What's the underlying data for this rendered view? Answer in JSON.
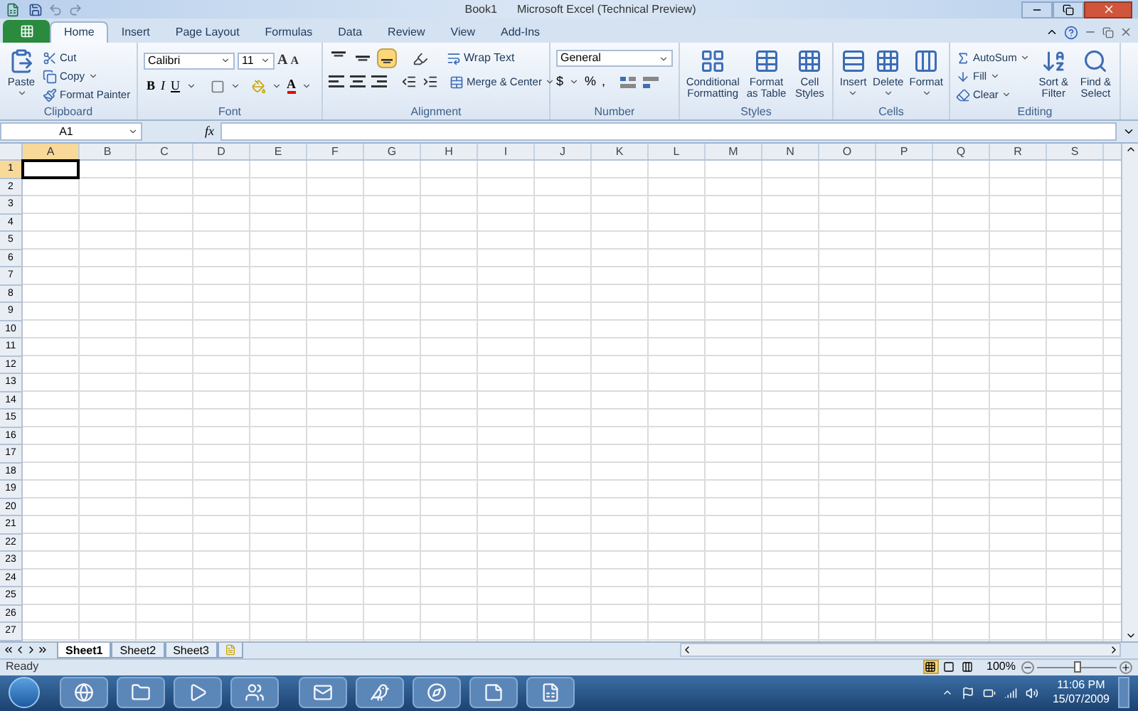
{
  "title_bar": {
    "document": "Book1",
    "app": "Microsoft Excel (Technical Preview)"
  },
  "tabs": [
    {
      "label": "Home",
      "selected": true
    },
    {
      "label": "Insert",
      "selected": false
    },
    {
      "label": "Page Layout",
      "selected": false
    },
    {
      "label": "Formulas",
      "selected": false
    },
    {
      "label": "Data",
      "selected": false
    },
    {
      "label": "Review",
      "selected": false
    },
    {
      "label": "View",
      "selected": false
    },
    {
      "label": "Add-Ins",
      "selected": false
    }
  ],
  "clipboard": {
    "name": "Clipboard",
    "paste": "Paste",
    "cut": "Cut",
    "copy": "Copy",
    "format_painter": "Format Painter"
  },
  "font": {
    "name": "Font",
    "family": "Calibri",
    "size": "11",
    "grow": "A",
    "shrink": "A",
    "bold": "B",
    "italic": "I",
    "underline": "U",
    "font_color": "A"
  },
  "alignment": {
    "name": "Alignment",
    "vertical": [
      {
        "kind": "top",
        "selected": false
      },
      {
        "kind": "middle",
        "selected": false
      },
      {
        "kind": "bottom",
        "selected": true
      }
    ],
    "wrap_text": "Wrap Text",
    "merge": "Merge & Center"
  },
  "number": {
    "name": "Number",
    "format": "General",
    "currency": "$",
    "percent": "%",
    "comma": ","
  },
  "styles": {
    "name": "Styles",
    "buttons": [
      "Conditional Formatting",
      "Format as Table",
      "Cell Styles"
    ]
  },
  "cells": {
    "name": "Cells",
    "buttons": [
      "Insert",
      "Delete",
      "Format"
    ]
  },
  "editing": {
    "name": "Editing",
    "small": [
      "AutoSum",
      "Fill",
      "Clear"
    ],
    "large": [
      "Sort & Filter",
      "Find & Select"
    ]
  },
  "formula_bar": {
    "name_box": "A1",
    "function_label": "fx"
  },
  "columns": [
    {
      "label": "A",
      "selected": true
    },
    {
      "label": "B",
      "selected": false
    },
    {
      "label": "C",
      "selected": false
    },
    {
      "label": "D",
      "selected": false
    },
    {
      "label": "E",
      "selected": false
    },
    {
      "label": "F",
      "selected": false
    },
    {
      "label": "G",
      "selected": false
    },
    {
      "label": "H",
      "selected": false
    },
    {
      "label": "I",
      "selected": false
    },
    {
      "label": "J",
      "selected": false
    },
    {
      "label": "K",
      "selected": false
    },
    {
      "label": "L",
      "selected": false
    },
    {
      "label": "M",
      "selected": false
    },
    {
      "label": "N",
      "selected": false
    },
    {
      "label": "O",
      "selected": false
    },
    {
      "label": "P",
      "selected": false
    },
    {
      "label": "Q",
      "selected": false
    },
    {
      "label": "R",
      "selected": false
    },
    {
      "label": "S",
      "selected": false
    }
  ],
  "rows": [
    {
      "label": "1",
      "selected": true
    },
    {
      "label": "2",
      "selected": false
    },
    {
      "label": "3",
      "selected": false
    },
    {
      "label": "4",
      "selected": false
    },
    {
      "label": "5",
      "selected": false
    },
    {
      "label": "6",
      "selected": false
    },
    {
      "label": "7",
      "selected": false
    },
    {
      "label": "8",
      "selected": false
    },
    {
      "label": "9",
      "selected": false
    },
    {
      "label": "10",
      "selected": false
    },
    {
      "label": "11",
      "selected": false
    },
    {
      "label": "12",
      "selected": false
    },
    {
      "label": "13",
      "selected": false
    },
    {
      "label": "14",
      "selected": false
    },
    {
      "label": "15",
      "selected": false
    },
    {
      "label": "16",
      "selected": false
    },
    {
      "label": "17",
      "selected": false
    },
    {
      "label": "18",
      "selected": false
    },
    {
      "label": "19",
      "selected": false
    },
    {
      "label": "20",
      "selected": false
    },
    {
      "label": "21",
      "selected": false
    },
    {
      "label": "22",
      "selected": false
    },
    {
      "label": "23",
      "selected": false
    },
    {
      "label": "24",
      "selected": false
    },
    {
      "label": "25",
      "selected": false
    },
    {
      "label": "26",
      "selected": false
    },
    {
      "label": "27",
      "selected": false
    }
  ],
  "sheets": [
    {
      "label": "Sheet1",
      "selected": true
    },
    {
      "label": "Sheet2",
      "selected": false
    },
    {
      "label": "Sheet3",
      "selected": false
    }
  ],
  "status": "Ready",
  "view_buttons": [
    {
      "kind": "normal",
      "selected": true
    },
    {
      "kind": "layout",
      "selected": false
    },
    {
      "kind": "break",
      "selected": false
    }
  ],
  "zoom": {
    "reading": "100%",
    "level": 0.5
  },
  "clock": {
    "time": "11:06 PM",
    "date": "15/07/2009"
  }
}
